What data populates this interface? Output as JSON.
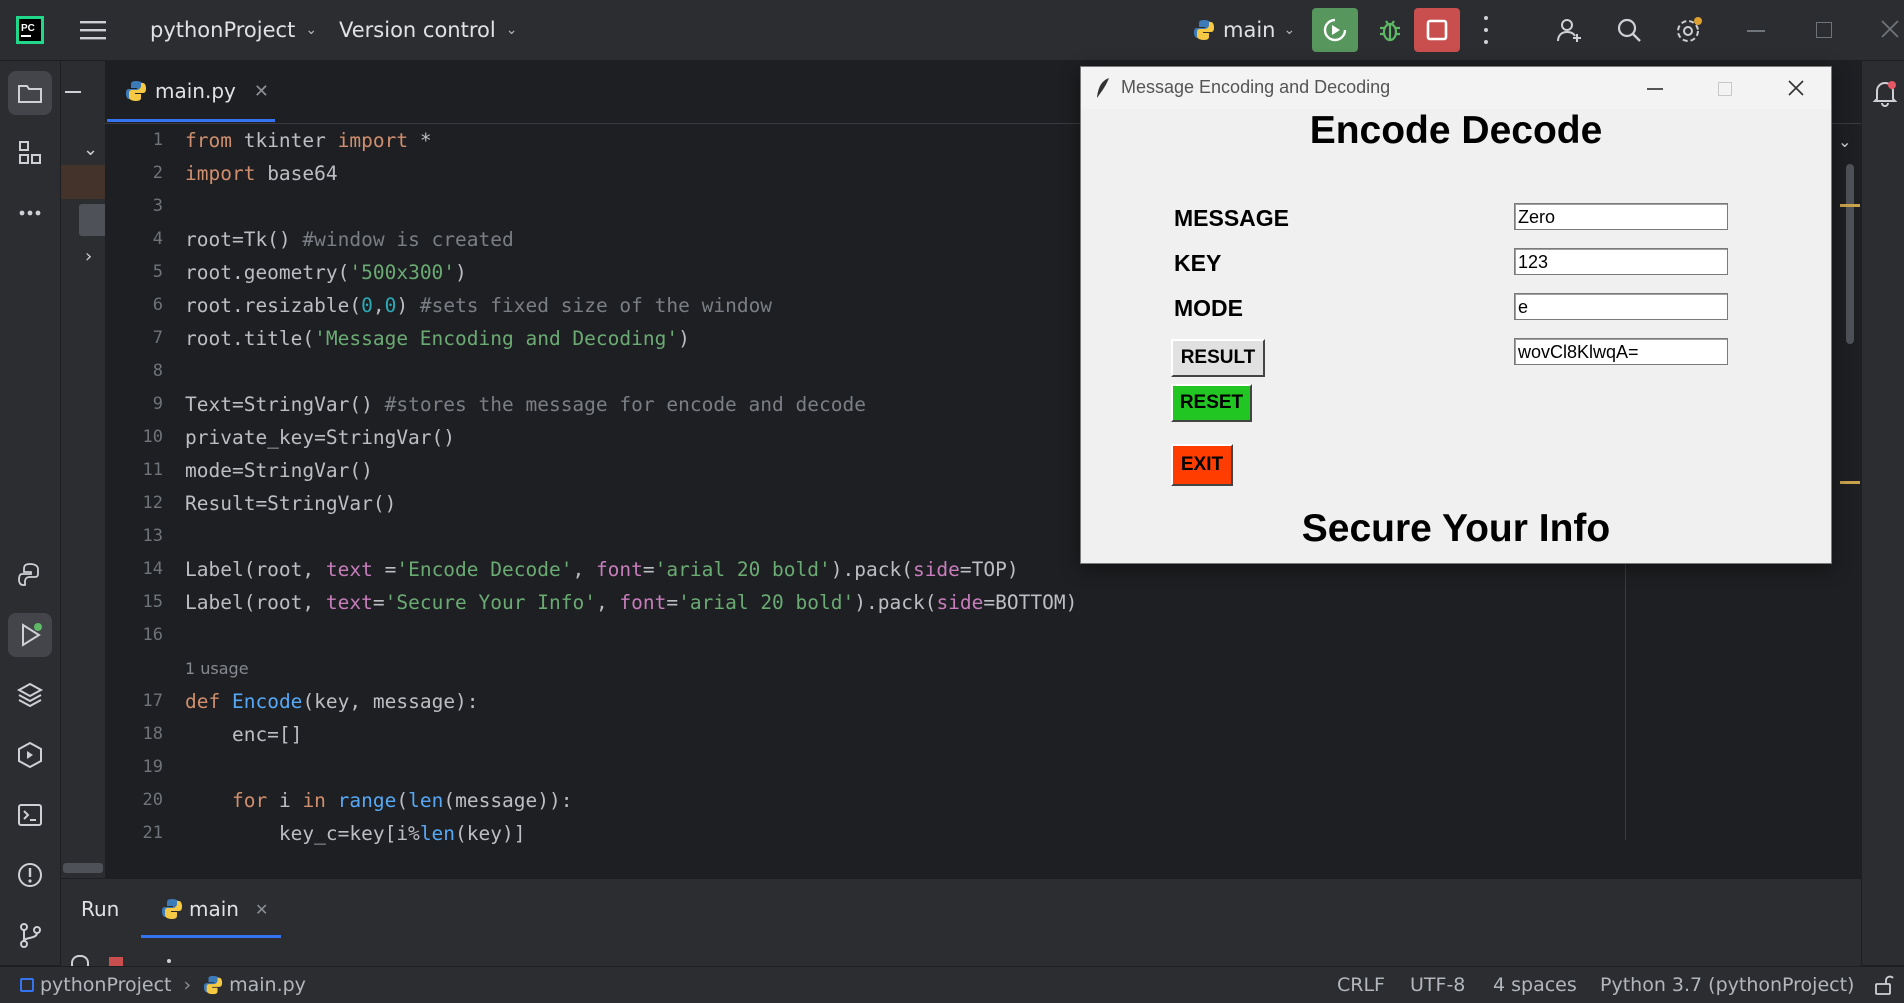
{
  "titlebar": {
    "project": "pythonProject",
    "vcs": "Version control",
    "run_config": "main"
  },
  "tab": {
    "label": "main.py"
  },
  "tk_window": {
    "title": "Message Encoding and Decoding",
    "heading": "Encode Decode",
    "footer": "Secure Your Info",
    "labels": {
      "message": "MESSAGE",
      "key": "KEY",
      "mode": "MODE"
    },
    "values": {
      "message": "Zero",
      "key": "123",
      "mode": "e",
      "result": "wovCl8KlwqA="
    },
    "buttons": {
      "result": "RESULT",
      "reset": "RESET",
      "exit": "EXIT"
    },
    "colors": {
      "reset_bg": "#22c622",
      "exit_bg": "#ff3d00",
      "result_bg": "#e1e1e1"
    }
  },
  "editor": {
    "line_numbers": [
      "1",
      "2",
      "3",
      "4",
      "5",
      "6",
      "7",
      "8",
      "9",
      "10",
      "11",
      "12",
      "13",
      "14",
      "15",
      "16",
      "",
      "17",
      "18",
      "19",
      "20",
      "21"
    ],
    "usage_hint": "1 usage"
  },
  "run_panel": {
    "tab_run": "Run",
    "tab_main": "main"
  },
  "statusbar": {
    "project": "pythonProject",
    "file": "main.py",
    "line_sep": "CRLF",
    "encoding": "UTF-8",
    "indent": "4 spaces",
    "interpreter": "Python 3.7 (pythonProject)"
  },
  "colors": {
    "ide_bg": "#1e1f22",
    "panel_bg": "#2b2d30",
    "run_green": "#57965c",
    "stop_red": "#c94f4f"
  }
}
